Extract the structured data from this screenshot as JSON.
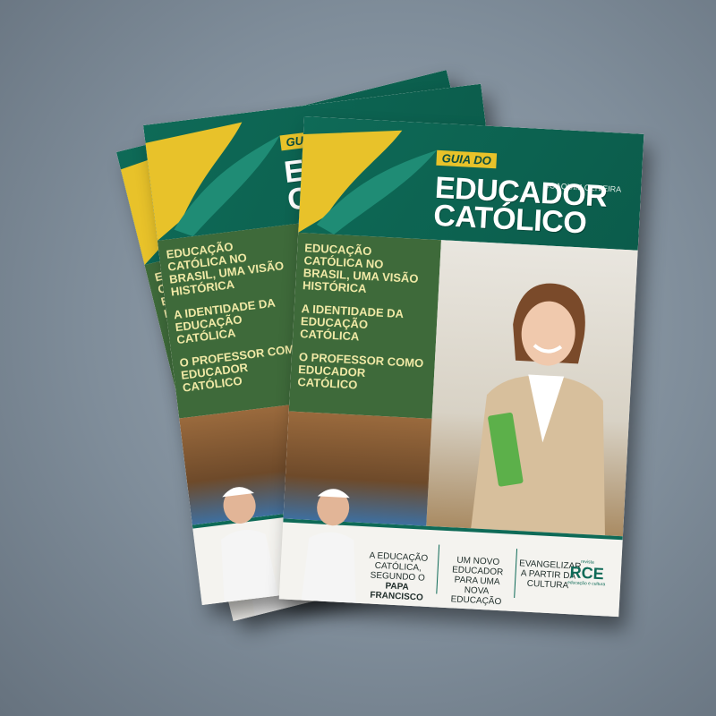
{
  "magazine": {
    "series_label": "GUIA DO",
    "title_line1": "EDUCADOR",
    "title_line2": "CATÓLICO",
    "author": "JOAQUIM OLIVEIRA",
    "topics": [
      "EDUCAÇÃO CATÓLICA NO BRASIL, UMA VISÃO HISTÓRICA",
      "A IDENTIDADE DA EDUCAÇÃO CATÓLICA",
      "O PROFESSOR COMO EDUCADOR CATÓLICO"
    ],
    "bottom_columns": [
      {
        "text": "A EDUCAÇÃO\nCATÓLICA,\nSEGUNDO O",
        "bold": "PAPA FRANCISCO"
      },
      {
        "text": "UM NOVO\nEDUCADOR\nPARA UMA\nNOVA EDUCAÇÃO",
        "bold": ""
      },
      {
        "text": "EVANGELIZAR\nA PARTIR DA\nCULTURA",
        "bold": ""
      }
    ],
    "logo": {
      "tag": "revista",
      "name": "RCE",
      "sub": "educação e cultura"
    }
  },
  "colors": {
    "green": "#0e6a57",
    "gold": "#e8c22a",
    "topic_text": "#f0e9a6"
  }
}
